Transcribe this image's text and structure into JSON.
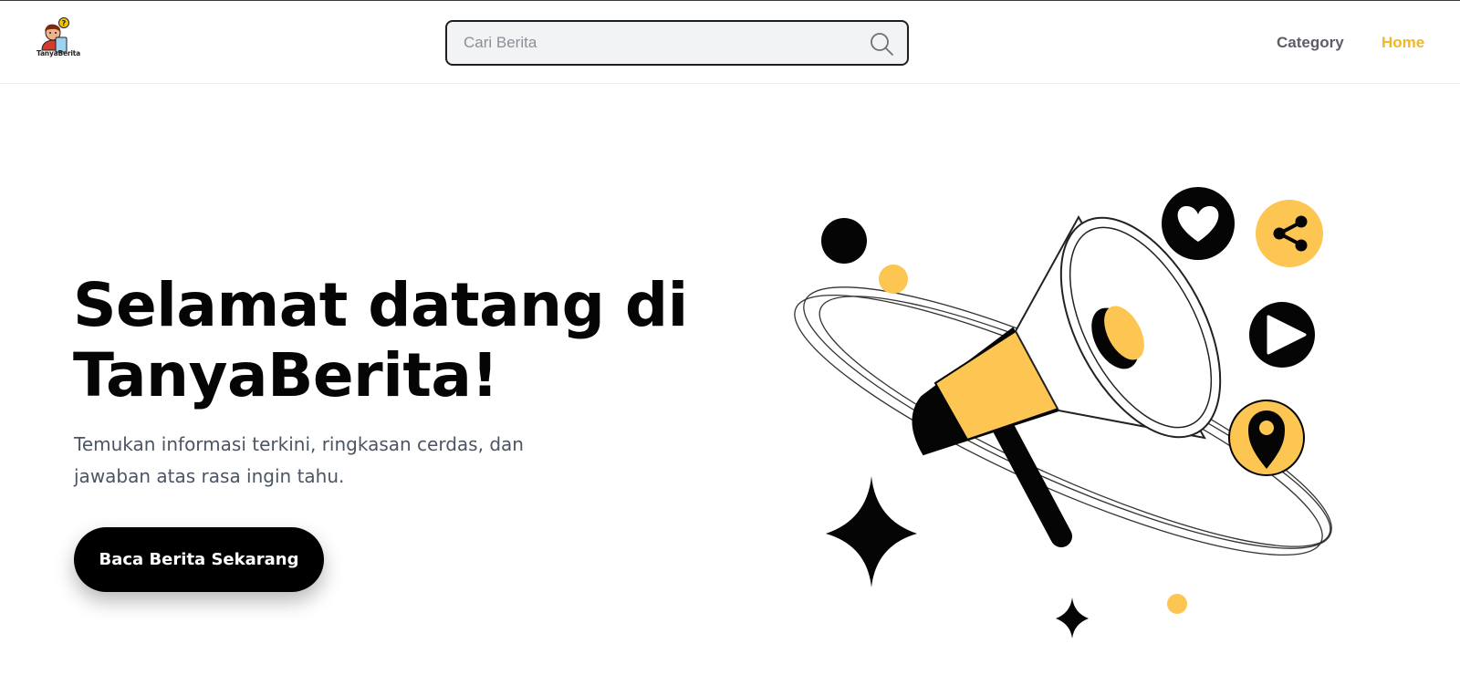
{
  "header": {
    "logo_text": "TanyaBerita",
    "search": {
      "placeholder": "Cari Berita",
      "value": ""
    },
    "nav": [
      {
        "label": "Category"
      },
      {
        "label": "Home",
        "active": true
      }
    ]
  },
  "hero": {
    "title_line1": "Selamat datang di",
    "title_line2": "TanyaBerita!",
    "subtitle_line1": "Temukan informasi terkini, ringkasan cerdas, dan",
    "subtitle_line2": "jawaban atas rasa ingin tahu.",
    "cta_label": "Baca Berita Sekarang"
  },
  "illustration": {
    "icons": [
      "megaphone-icon",
      "heart-icon",
      "share-icon",
      "play-icon",
      "location-pin-icon",
      "sparkle-icon"
    ]
  },
  "colors": {
    "accent": "#f3b624",
    "illustration_yellow": "#fdc652",
    "text_dark": "#050505",
    "text_muted": "#4b5563",
    "nav_muted": "#5a5e66",
    "search_bg": "#f2f3f5"
  }
}
